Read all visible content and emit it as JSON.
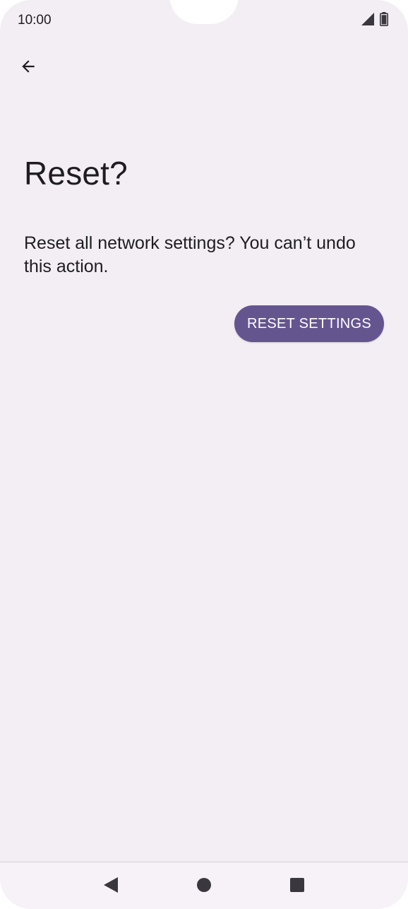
{
  "status_bar": {
    "time": "10:00",
    "icons": [
      "signal-icon",
      "battery-icon"
    ]
  },
  "toolbar": {
    "back_icon": "arrow-back-icon"
  },
  "content": {
    "title": "Reset?",
    "description": "Reset all network settings? You can’t undo this action.",
    "reset_button_label": "RESET SETTINGS"
  },
  "nav_bar": {
    "icons": [
      "nav-back-icon",
      "nav-home-icon",
      "nav-recents-icon"
    ]
  },
  "colors": {
    "background": "#f3eef4",
    "primary_button": "#65558f",
    "text": "#1e1c22"
  }
}
